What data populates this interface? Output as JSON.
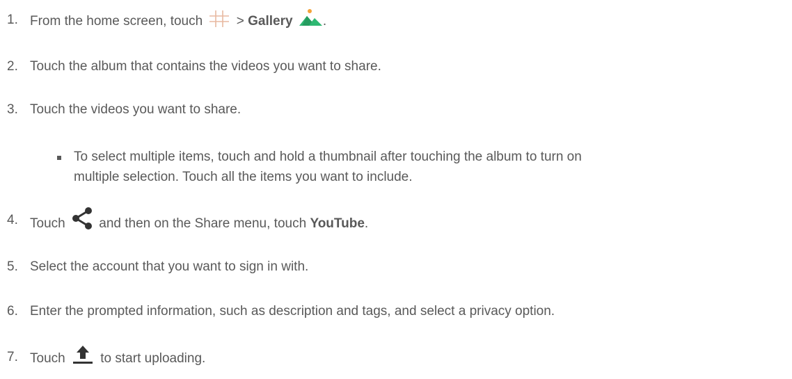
{
  "steps": [
    {
      "num": "1.",
      "pre": "From the home screen, touch",
      "icon1": "apps-grid-icon",
      "sep": ">",
      "bold": "Gallery",
      "icon2": "gallery-icon",
      "post": "."
    },
    {
      "num": "2.",
      "text": "Touch the album that contains the videos you want to share."
    },
    {
      "num": "3.",
      "text": "Touch the videos you want to share."
    },
    {
      "num": "4.",
      "pre": "Touch",
      "icon": "share-icon",
      "mid": "and then on the Share menu, touch",
      "bold": "YouTube",
      "post": "."
    },
    {
      "num": "5.",
      "text": "Select the account that you want to sign in with."
    },
    {
      "num": "6.",
      "text": "Enter the prompted information, such as description and tags, and select a privacy option."
    },
    {
      "num": "7.",
      "pre": "Touch",
      "icon": "upload-icon",
      "post": "to start uploading."
    }
  ],
  "sub_bullet": {
    "line1": "To select multiple items, touch and hold a thumbnail after touching the album to turn on",
    "line2": "multiple selection. Touch all the items you want to include."
  },
  "colors": {
    "text": "#595959",
    "grid_icon": "#e8b9a0",
    "gallery_green": "#2eb872",
    "gallery_sun": "#f3a33a"
  }
}
